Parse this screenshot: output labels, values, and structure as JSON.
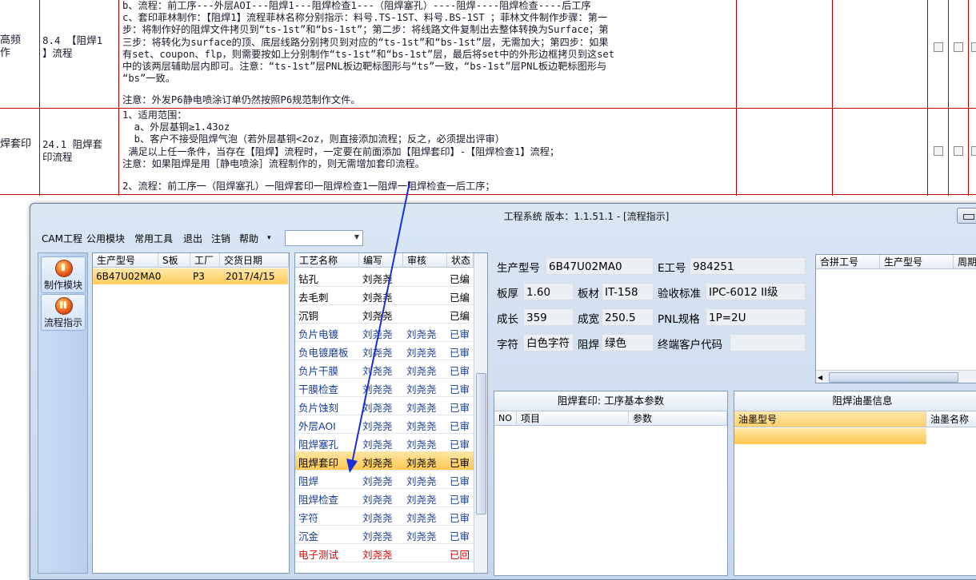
{
  "document": {
    "row1": {
      "col1": "高频\n作",
      "col2": "8.4 【阻焊1\n】流程",
      "text": "b、流程：前工序---外层AOI---阻焊1---阻焊检查1---（阻焊塞孔）----阻焊----阻焊检查----后工序\nc、套印菲林制作：【阻焊1】流程菲林名称分别指示：料号.TS-1ST、料号.BS-1ST ；菲林文件制作步骤：第一\n步：将制作好的阻焊文件拷贝到“ts-1st”和“bs-1st”；第二步：将线路文件复制出去整体转换为Surface；第\n三步：将转化为surface的顶、底层线路分别拷贝到对应的“ts-1st”和“bs-1st”层，无需加大；第四步：如果\n有set、coupon、flp，则需要按如上分别制作“ts-1st”和“bs-1st”层，最后将set中的外形边框拷贝到这set\n中的该两层辅助层内即可。注意：“ts-1st”层PNL板边靶标图形与“ts”一致，“bs-1st”层PNL板边靶标图形与\n“bs”一致。",
      "note": "注意：外发P6静电喷涂订单仍然按照P6规范制作文件。"
    },
    "row2": {
      "col1": "焊套印",
      "col2": "24.1 阻焊套\n印流程",
      "text": "1、适用范围：\n  a、外层基铜≥1.43oz\n  b、客户不接受阻焊气泡（若外层基铜<2oz，则直接添加流程；反之，必须提出评审）\n 满足以上任一条件，当存在【阻焊】流程时，一定要在前面添加【阻焊套印】-【阻焊检查1】流程；\n注意：如果阻焊是用［静电喷涂］流程制作的，则无需增加套印流程。",
      "flow": "2、流程：前工序一（阻焊塞孔）一阻焊套印一阻焊检查1一阻焊一阻焊检查一后工序；"
    }
  },
  "window": {
    "title": "工程系统  版本：1.1.51.1 - [流程指示]",
    "menu": [
      "CAM工程",
      "公用模块",
      "常用工具",
      "退出",
      "注销",
      "帮助"
    ],
    "menu_dropdown_arrow": "▾",
    "combo_value": "",
    "toolbar": [
      {
        "label": "制作模块",
        "icon": "fire-icon"
      },
      {
        "label": "流程指示",
        "icon": "pause-icon"
      }
    ]
  },
  "products": {
    "headers": [
      "生产型号",
      "S板",
      "工厂",
      "交货日期"
    ],
    "rows": [
      [
        "6B47U02MA0",
        "",
        "P3",
        "2017/4/15"
      ]
    ]
  },
  "process": {
    "headers": [
      "工艺名称",
      "编写",
      "审核",
      "状态"
    ],
    "rows": [
      {
        "name": "钻孔",
        "writer": "刘尧尧",
        "reviewer": "",
        "status": "已编",
        "color": "black"
      },
      {
        "name": "去毛刺",
        "writer": "刘尧尧",
        "reviewer": "",
        "status": "已编",
        "color": "black"
      },
      {
        "name": "沉铜",
        "writer": "刘尧尧",
        "reviewer": "",
        "status": "已编",
        "color": "black"
      },
      {
        "name": "负片电镀",
        "writer": "刘尧尧",
        "reviewer": "刘尧尧",
        "status": "已审",
        "color": "blue"
      },
      {
        "name": "负电镀磨板",
        "writer": "刘尧尧",
        "reviewer": "刘尧尧",
        "status": "已审",
        "color": "blue"
      },
      {
        "name": "负片干膜",
        "writer": "刘尧尧",
        "reviewer": "刘尧尧",
        "status": "已审",
        "color": "blue"
      },
      {
        "name": "干膜检查",
        "writer": "刘尧尧",
        "reviewer": "刘尧尧",
        "status": "已审",
        "color": "blue"
      },
      {
        "name": "负片蚀刻",
        "writer": "刘尧尧",
        "reviewer": "刘尧尧",
        "status": "已审",
        "color": "blue"
      },
      {
        "name": "外层AOI",
        "writer": "刘尧尧",
        "reviewer": "刘尧尧",
        "status": "已审",
        "color": "blue"
      },
      {
        "name": "阻焊塞孔",
        "writer": "刘尧尧",
        "reviewer": "刘尧尧",
        "status": "已审",
        "color": "blue"
      },
      {
        "name": "阻焊套印",
        "writer": "刘尧尧",
        "reviewer": "刘尧尧",
        "status": "已审",
        "color": "black",
        "selected": true
      },
      {
        "name": "阻焊",
        "writer": "刘尧尧",
        "reviewer": "刘尧尧",
        "status": "已审",
        "color": "blue"
      },
      {
        "name": "阻焊检查",
        "writer": "刘尧尧",
        "reviewer": "刘尧尧",
        "status": "已审",
        "color": "blue"
      },
      {
        "name": "字符",
        "writer": "刘尧尧",
        "reviewer": "刘尧尧",
        "status": "已审",
        "color": "blue"
      },
      {
        "name": "沉金",
        "writer": "刘尧尧",
        "reviewer": "刘尧尧",
        "status": "已审",
        "color": "blue"
      },
      {
        "name": "电子测试",
        "writer": "刘尧尧",
        "reviewer": "",
        "status": "已回",
        "color": "red"
      }
    ]
  },
  "info": {
    "model_label": "生产型号",
    "model": "6B47U02MA0",
    "e_label": "E工号",
    "e": "984251",
    "thick_label": "板厚",
    "thick": "1.60",
    "material_label": "板材",
    "material": "IT-158",
    "std_label": "验收标准",
    "std": "IPC-6012 II级",
    "len_label": "成长",
    "len": "359",
    "wid_label": "成宽",
    "wid": "250.5",
    "pnl_label": "PNL规格",
    "pnl": "1P=2U",
    "char_label": "字符",
    "char": "白色字符",
    "mask_label": "阻焊",
    "mask": "绿色",
    "client_label": "终端客户代码",
    "client": ""
  },
  "merge": {
    "headers": [
      "合拼工号",
      "生产型号",
      "周期"
    ]
  },
  "params": {
    "title": "阻焊套印: 工序基本参数",
    "headers": [
      "NO",
      "项目",
      "参数"
    ]
  },
  "ink": {
    "title": "阻焊油墨信息",
    "headers": [
      "油墨型号",
      "油墨名称"
    ]
  },
  "colors": {
    "selection": "#ffc84f",
    "doc_border": "#c00000",
    "arrow": "#1a2fd6",
    "text_blue": "#1a3e8f",
    "text_red": "#d40000"
  }
}
